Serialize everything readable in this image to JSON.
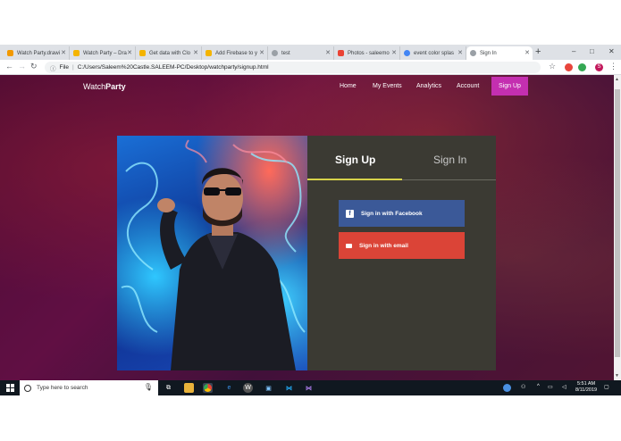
{
  "browser": {
    "tabs": [
      {
        "title": "Watch Party.drawi",
        "color": "#f29900"
      },
      {
        "title": "Watch Party – Dra",
        "color": "#f4b400"
      },
      {
        "title": "Get data with Clo",
        "color": "#f4b400"
      },
      {
        "title": "Add Firebase to y",
        "color": "#f4b400"
      },
      {
        "title": "test",
        "color": "#9aa0a6"
      },
      {
        "title": "Photos - saleemo",
        "color": "#ea4335"
      },
      {
        "title": "event color splas",
        "color": "#4285f4"
      },
      {
        "title": "Sign In",
        "color": "#9aa0a6"
      }
    ],
    "new_tab": "+",
    "window_controls": [
      "–",
      "□",
      "✕"
    ],
    "address": {
      "label": "File",
      "url": "C:/Users/Saleem%20Castle.SALEEM-PC/Desktop/watchparty/signup.html"
    },
    "profile_initial": "S"
  },
  "site": {
    "brand_light": "Watch",
    "brand_bold": "Party",
    "nav": [
      "Home",
      "My Events",
      "Analytics",
      "Account"
    ],
    "signup_button": "Sign Up"
  },
  "form": {
    "tab_signup": "Sign Up",
    "tab_signin": "Sign In",
    "facebook_label": "Sign in with Facebook",
    "email_label": "Sign in with email",
    "colors": {
      "facebook": "#3b5998",
      "email": "#db4437",
      "accent": "#d6d24a",
      "brand": "#c42fb0"
    }
  },
  "taskbar": {
    "search_placeholder": "Type here to search",
    "time": "5:51 AM",
    "date": "8/11/2019"
  }
}
